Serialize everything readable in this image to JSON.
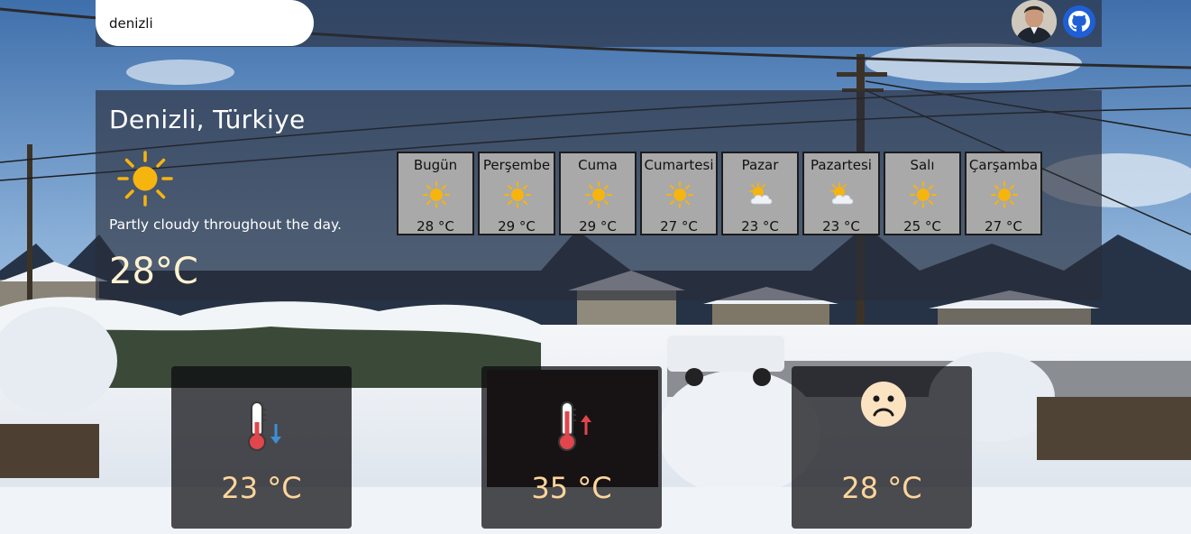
{
  "search": {
    "value": "denizli",
    "placeholder": ""
  },
  "location": "Denizli, Türkiye",
  "current": {
    "icon": "sun-icon",
    "description": "Partly cloudy throughout the day.",
    "temperature": "28°C"
  },
  "forecast": [
    {
      "day": "Bugün",
      "icon": "sun-icon",
      "temp": "28 °C"
    },
    {
      "day": "Perşembe",
      "icon": "sun-icon",
      "temp": "29 °C"
    },
    {
      "day": "Cuma",
      "icon": "sun-icon",
      "temp": "29 °C"
    },
    {
      "day": "Cumartesi",
      "icon": "sun-icon",
      "temp": "27 °C"
    },
    {
      "day": "Pazar",
      "icon": "partly-cloudy-icon",
      "temp": "23 °C"
    },
    {
      "day": "Pazartesi",
      "icon": "partly-cloudy-icon",
      "temp": "23 °C"
    },
    {
      "day": "Salı",
      "icon": "sun-icon",
      "temp": "25 °C"
    },
    {
      "day": "Çarşamba",
      "icon": "sun-icon",
      "temp": "27 °C"
    }
  ],
  "stats": [
    {
      "icon": "thermometer-low-icon",
      "value": "23 °C"
    },
    {
      "icon": "thermometer-high-icon",
      "value": "35 °C"
    },
    {
      "icon": "sad-face-icon",
      "value": "28 °C"
    }
  ],
  "colors": {
    "panel": "#282c38",
    "card_text": "#ffd69b",
    "forecast_tile": "#a9a9a9",
    "sun": "#f6b40e",
    "github": "#1f5fd6"
  }
}
